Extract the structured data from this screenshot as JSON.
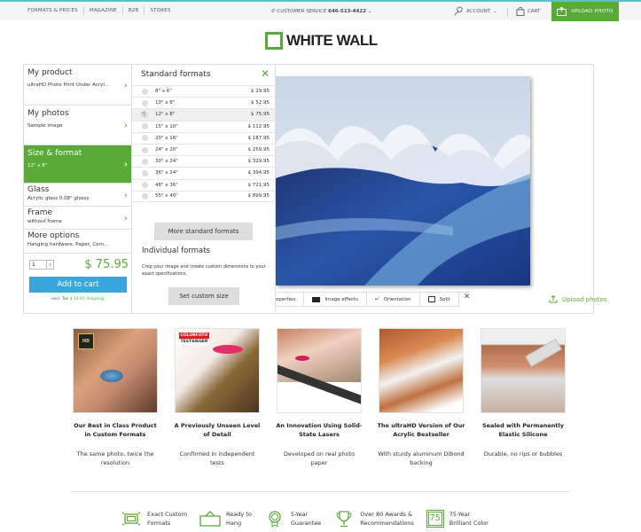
{
  "topbar": {
    "nav": [
      "FORMATS & PRICES",
      "MAGAZINE",
      "B2B",
      "STORES"
    ],
    "customer_service_label": "CUSTOMER SERVICE",
    "customer_service_phone": "646-513-4422",
    "account_label": "ACCOUNT",
    "cart_label": "CART",
    "upload_label": "UPLOAD PHOTO"
  },
  "logo": {
    "text": "WHITE WALL"
  },
  "config": {
    "items": [
      {
        "title": "My product",
        "sub": "ultraHD Photo Print Under Acryl..."
      },
      {
        "title": "My photos",
        "sub": "Sample image"
      },
      {
        "title": "Size & format",
        "sub": "12\" x 8\""
      },
      {
        "title": "Glass",
        "sub": "Acrylic glass 0.08\" glossy"
      },
      {
        "title": "Frame",
        "sub": "without frame"
      },
      {
        "title": "More options",
        "sub": "Hanging hardware, Paper, Corn..."
      }
    ],
    "quantity": "1",
    "price": "$ 75.95",
    "add_to_cart": "Add to cart",
    "tax_label": "excl. Tax",
    "shipping": "$ 14.95 Shipping"
  },
  "formats": {
    "title": "Standard formats",
    "rows": [
      {
        "size": "8\" x 6\"",
        "price": "$ 29.95"
      },
      {
        "size": "10\" x 8\"",
        "price": "$ 52.95"
      },
      {
        "size": "12\" x 8\"",
        "price": "$ 75.95"
      },
      {
        "size": "15\" x 10\"",
        "price": "$ 112.95"
      },
      {
        "size": "20\" x 16\"",
        "price": "$ 187.95"
      },
      {
        "size": "24\" x 20\"",
        "price": "$ 259.95"
      },
      {
        "size": "30\" x 24\"",
        "price": "$ 329.95"
      },
      {
        "size": "36\" x 24\"",
        "price": "$ 394.95"
      },
      {
        "size": "48\" x 36\"",
        "price": "$ 721.95"
      },
      {
        "size": "55\" x 40\"",
        "price": "$ 899.95"
      }
    ],
    "more_button": "More standard formats",
    "individual_title": "Individual formats",
    "individual_text": "Crop your image and create custom dimensions to your exact specifications.",
    "custom_button": "Set custom size"
  },
  "toolbar": {
    "properties": "operties",
    "image_effects": "Image effects",
    "orientation": "Orientation",
    "split": "Split"
  },
  "upload_photos": "Upload photos",
  "features": [
    {
      "title": "Our Best in Class Product in Custom Formats",
      "desc": "The same photo, twice the resolution",
      "badge": "ultra HD PRINT"
    },
    {
      "title": "A Previously Unseen Level of Detail",
      "desc": "Confirmed in independent tests",
      "badge": "COLORFOTO TESTSIEGER"
    },
    {
      "title": "An Innovation Using Solid-State Lasers",
      "desc": "Developed on real photo paper"
    },
    {
      "title": "The ultraHD Version of Our Acrylic Bestseller",
      "desc": "With sturdy aluminum Dibond backing"
    },
    {
      "title": "Sealed with Permanently Elastic Silicone",
      "desc": "Durable, no rips or bubbles"
    }
  ],
  "usps": [
    {
      "icon": "custom-format-icon",
      "line1": "Exact Custom",
      "line2": "Formats"
    },
    {
      "icon": "hanging-icon",
      "line1": "Ready to",
      "line2": "Hang"
    },
    {
      "icon": "award-ribbon-icon",
      "line1": "5-Year",
      "line2": "Guarantee"
    },
    {
      "icon": "trophy-icon",
      "line1": "Over 80 Awards &",
      "line2": "Recommendations"
    },
    {
      "icon": "75-badge-icon",
      "line1": "75-Year",
      "line2": "Brilliant Color",
      "badge": "75"
    }
  ],
  "colors": {
    "brand_green": "#5aaa3a",
    "cart_blue": "#39a7dc",
    "top_accent": "#5cc0c6"
  }
}
